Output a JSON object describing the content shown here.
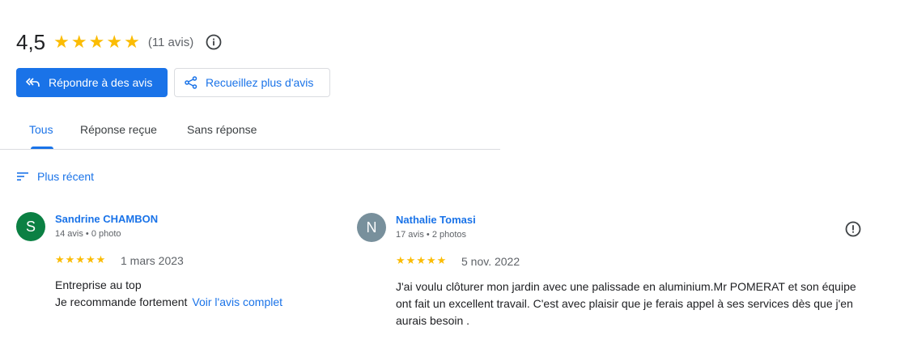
{
  "summary": {
    "rating": "4,5",
    "stars": 5,
    "count_label": "(11 avis)",
    "info_icon": "info-icon"
  },
  "buttons": {
    "reply_label": "Répondre à des avis",
    "collect_label": "Recueillez plus d'avis"
  },
  "tabs": [
    {
      "label": "Tous",
      "active": true
    },
    {
      "label": "Réponse reçue",
      "active": false
    },
    {
      "label": "Sans réponse",
      "active": false
    }
  ],
  "sort": {
    "label": "Plus récent",
    "icon": "sort-icon"
  },
  "reviews": [
    {
      "initial": "S",
      "avatar_color": "#0b8043",
      "name": "Sandrine CHAMBON",
      "meta": "14 avis • 0 photo",
      "stars": 5,
      "date": "1 mars 2023",
      "text_line1": "Entreprise au top",
      "text_line2": "Je recommande fortement",
      "more_link": "Voir l'avis complet"
    },
    {
      "initial": "N",
      "avatar_color": "#78909c",
      "name": "Nathalie Tomasi",
      "meta": "17 avis • 2 photos",
      "stars": 5,
      "date": "5 nov. 2022",
      "text_line1": "J'ai voulu clôturer mon jardin avec une palissade en aluminium.Mr POMERAT et son équipe",
      "text_line2": "ont fait un excellent travail. C'est avec plaisir que je ferais appel à ses services dès que j'en",
      "text_line3": "aurais besoin ."
    }
  ],
  "colors": {
    "accent": "#1a73e8",
    "star": "#fbbc04"
  }
}
